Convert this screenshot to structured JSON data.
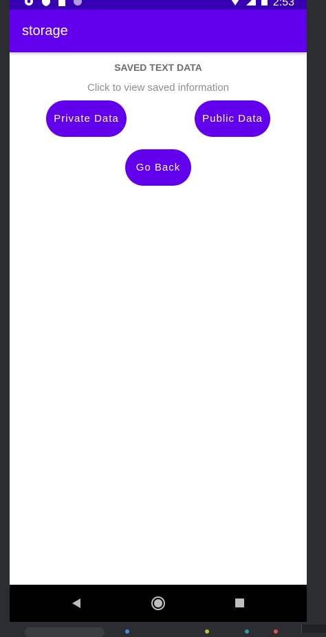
{
  "status_bar": {
    "time": "2:53",
    "left_icons": [
      "settings-icon",
      "shield-icon",
      "sd-card-icon",
      "circle-icon"
    ],
    "right_icons": [
      "wifi-icon",
      "signal-icon",
      "battery-icon"
    ]
  },
  "app_bar": {
    "title": "storage"
  },
  "main": {
    "heading": "SAVED TEXT DATA",
    "subtext": "Click to view saved information",
    "private_button": "Private Data",
    "public_button": "Public Data",
    "back_button": "Go Back"
  },
  "nav_bar": {
    "icons": [
      "back-icon",
      "home-icon",
      "recents-icon"
    ]
  },
  "colors": {
    "status_bar": "#3700b3",
    "primary": "#6200ee",
    "heading_text": "#6b6b6b",
    "subtext": "#8e8e8e",
    "nav_bar": "#000000",
    "background": "#ffffff"
  }
}
